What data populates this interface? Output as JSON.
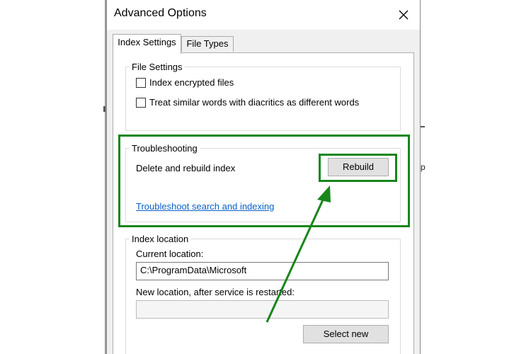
{
  "window": {
    "title": "Advanced Options",
    "close_icon": "close-icon"
  },
  "tabs": [
    {
      "label": "Index Settings",
      "active": true
    },
    {
      "label": "File Types",
      "active": false
    }
  ],
  "file_settings": {
    "legend": "File Settings",
    "options": [
      {
        "label": "Index encrypted files",
        "checked": false
      },
      {
        "label": "Treat similar words with diacritics as different words",
        "checked": false
      }
    ]
  },
  "troubleshooting": {
    "legend": "Troubleshooting",
    "rebuild_text": "Delete and rebuild index",
    "rebuild_button": "Rebuild",
    "troubleshoot_link": "Troubleshoot search and indexing"
  },
  "index_location": {
    "legend": "Index location",
    "current_label": "Current location:",
    "current_value": "C:\\ProgramData\\Microsoft",
    "new_label": "New location, after service is restarted:",
    "new_value": "",
    "select_button": "Select new"
  },
  "background": {
    "edge_char": "p"
  },
  "colors": {
    "annotation": "#17861b",
    "link": "#0b5fc6",
    "dialog_bg": "#f0f0f0"
  }
}
